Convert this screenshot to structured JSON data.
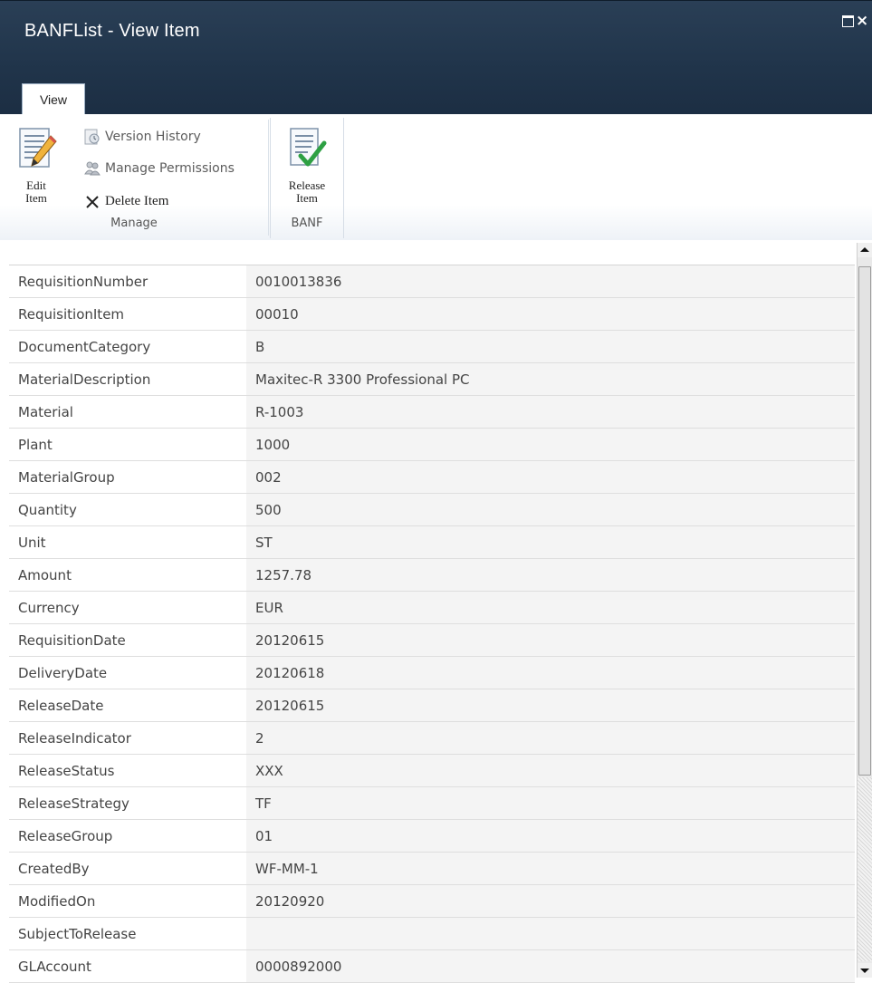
{
  "window": {
    "title": "BANFList - View Item",
    "maximize_icon": "maximize-icon",
    "close_icon": "close-icon",
    "close_glyph": "×"
  },
  "ribbon": {
    "tab_label": "View",
    "groups": [
      {
        "label": "Manage",
        "buttons": [
          {
            "label": "Edit Item",
            "icon": "edit-item-icon"
          },
          {
            "label": "Version History",
            "icon": "version-history-icon"
          },
          {
            "label": "Manage Permissions",
            "icon": "manage-permissions-icon"
          },
          {
            "label": "Delete Item",
            "icon": "delete-icon"
          }
        ]
      },
      {
        "label": "BANF",
        "buttons": [
          {
            "label": "Release Item",
            "icon": "release-item-icon"
          }
        ]
      }
    ]
  },
  "fields": [
    {
      "label": "RequisitionNumber",
      "value": "0010013836"
    },
    {
      "label": "RequisitionItem",
      "value": "00010"
    },
    {
      "label": "DocumentCategory",
      "value": "B"
    },
    {
      "label": "MaterialDescription",
      "value": "Maxitec-R 3300 Professional PC"
    },
    {
      "label": "Material",
      "value": "R-1003"
    },
    {
      "label": "Plant",
      "value": "1000"
    },
    {
      "label": "MaterialGroup",
      "value": "002"
    },
    {
      "label": "Quantity",
      "value": "500"
    },
    {
      "label": "Unit",
      "value": "ST"
    },
    {
      "label": "Amount",
      "value": "1257.78"
    },
    {
      "label": "Currency",
      "value": "EUR"
    },
    {
      "label": "RequisitionDate",
      "value": "20120615"
    },
    {
      "label": "DeliveryDate",
      "value": "20120618"
    },
    {
      "label": "ReleaseDate",
      "value": "20120615"
    },
    {
      "label": "ReleaseIndicator",
      "value": "2"
    },
    {
      "label": "ReleaseStatus",
      "value": "XXX"
    },
    {
      "label": "ReleaseStrategy",
      "value": "TF"
    },
    {
      "label": "ReleaseGroup",
      "value": "01"
    },
    {
      "label": "CreatedBy",
      "value": "WF-MM-1"
    },
    {
      "label": "ModifiedOn",
      "value": "20120920"
    },
    {
      "label": "SubjectToRelease",
      "value": ""
    },
    {
      "label": "GLAccount",
      "value": "0000892000"
    }
  ],
  "colors": {
    "titlebar": "#20344a",
    "accent_check": "#2ea043"
  }
}
